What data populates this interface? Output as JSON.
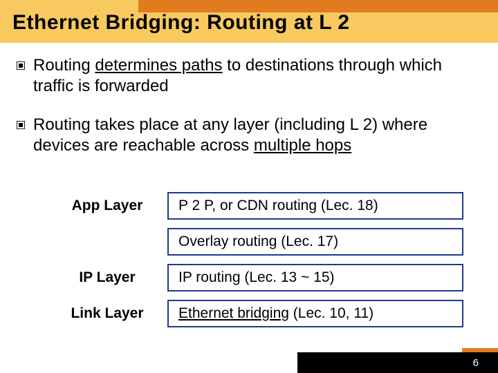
{
  "slide": {
    "title": "Ethernet Bridging: Routing at L 2",
    "bullets": [
      {
        "pre": "Routing ",
        "u": "determines paths",
        "post": " to destinations through which traffic is forwarded"
      },
      {
        "pre": "Routing takes place at any layer (including L 2) where devices are reachable across ",
        "u": "multiple hops",
        "post": ""
      }
    ],
    "table": [
      {
        "layer": "App Layer",
        "desc_pre": "P 2 P, or CDN routing (Lec. 18)",
        "desc_u": "",
        "desc_post": ""
      },
      {
        "layer": "",
        "desc_pre": "Overlay routing (Lec. 17)",
        "desc_u": "",
        "desc_post": ""
      },
      {
        "layer": "IP Layer",
        "desc_pre": "IP routing (Lec. 13 ~ 15)",
        "desc_u": "",
        "desc_post": ""
      },
      {
        "layer": "Link Layer",
        "desc_pre": "",
        "desc_u": "Ethernet bridging",
        "desc_post": " (Lec. 10, 11)"
      }
    ],
    "page_number": "6"
  }
}
